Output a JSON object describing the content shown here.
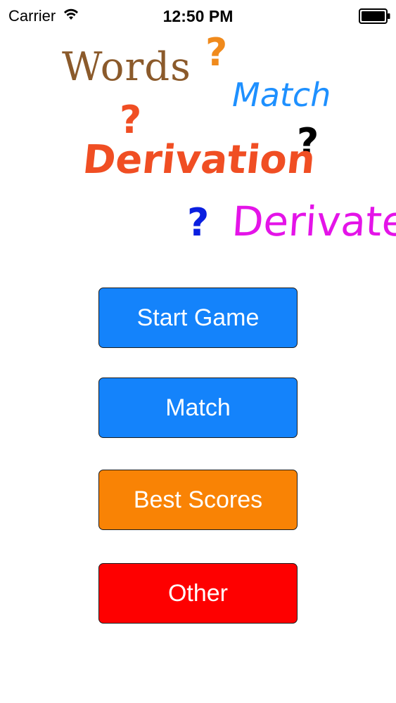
{
  "status_bar": {
    "carrier": "Carrier",
    "time": "12:50 PM",
    "wifi_icon": "wifi-icon",
    "battery_icon": "battery-full-icon"
  },
  "logo": {
    "words": [
      {
        "text": "Words",
        "color": "#8B5A2B"
      },
      {
        "text": "Match",
        "color": "#1E90FF"
      },
      {
        "text": "Derivation",
        "color": "#F04E23"
      },
      {
        "text": "Derivate",
        "color": "#E414E8"
      }
    ],
    "question_marks": [
      {
        "text": "?",
        "color": "#F08A1C"
      },
      {
        "text": "?",
        "color": "#F04E23"
      },
      {
        "text": "?",
        "color": "#000000"
      },
      {
        "text": "?",
        "color": "#0A1FE0"
      }
    ]
  },
  "menu": {
    "buttons": [
      {
        "label": "Start Game",
        "color": "#1483FB"
      },
      {
        "label": "Match",
        "color": "#1483FB"
      },
      {
        "label": "Best Scores",
        "color": "#F98305"
      },
      {
        "label": "Other",
        "color": "#FE0000"
      }
    ]
  }
}
